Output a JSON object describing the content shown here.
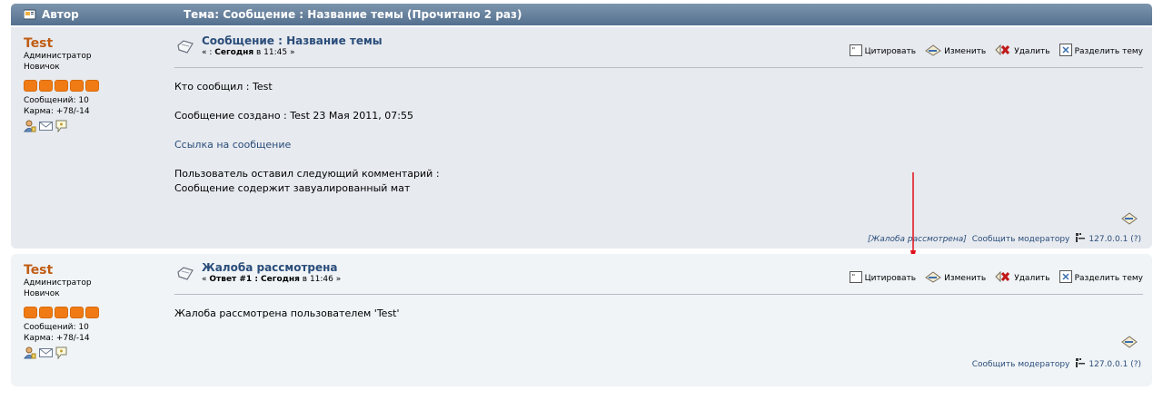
{
  "header": {
    "author_label": "Автор",
    "topic_label": "Тема: Сообщение : Название темы  (Прочитано 2 раз)"
  },
  "posts": [
    {
      "poster": {
        "name": "Test",
        "group": "Администратор",
        "rank": "Новичок",
        "stars": 5,
        "posts_count": "Сообщений: 10",
        "karma": "Карма: +78/-14"
      },
      "title": "Сообщение : Название темы",
      "meta_prefix": "« : ",
      "meta_bold": "Сегодня",
      "meta_suffix": " в 11:45 »",
      "body": {
        "line1": "Кто сообщил : Test",
        "line2": "Сообщение создано : Test 23 Мая 2011, 07:55",
        "link": "Ссылка на сообщение",
        "line3": "Пользователь оставил следующий комментарий :",
        "line4": "Сообщение содержит завуалированный мат"
      },
      "footer": {
        "complaint": "[Жалоба рассмотрена]",
        "report": "Сообщить модератору",
        "ip": "127.0.0.1 (?)"
      }
    },
    {
      "poster": {
        "name": "Test",
        "group": "Администратор",
        "rank": "Новичок",
        "stars": 5,
        "posts_count": "Сообщений: 10",
        "karma": "Карма: +78/-14"
      },
      "title": "Жалоба рассмотрена",
      "meta_prefix": "« ",
      "meta_bold": "Ответ #1 : Сегодня",
      "meta_suffix": " в 11:46 »",
      "body": {
        "line1": "Жалоба рассмотрена пользователем 'Test'"
      },
      "footer": {
        "report": "Сообщить модератору",
        "ip": "127.0.0.1 (?)"
      }
    }
  ],
  "actions": {
    "quote": "Цитировать",
    "edit": "Изменить",
    "delete": "Удалить",
    "split": "Разделить тему"
  },
  "colors": {
    "header_bg": "#5f7a97",
    "post1_bg": "#e7eaef",
    "post2_bg": "#f0f4f7",
    "username": "#c05d14",
    "link": "#2a4d7a",
    "star": "#f07b14",
    "annotation_arrow": "#e0101a"
  },
  "icons": [
    "author-icon",
    "topic-icon",
    "quote-icon",
    "edit-icon",
    "delete-icon",
    "split-icon",
    "profile-icon",
    "email-icon",
    "pm-icon",
    "modify-icon",
    "ip-icon"
  ]
}
